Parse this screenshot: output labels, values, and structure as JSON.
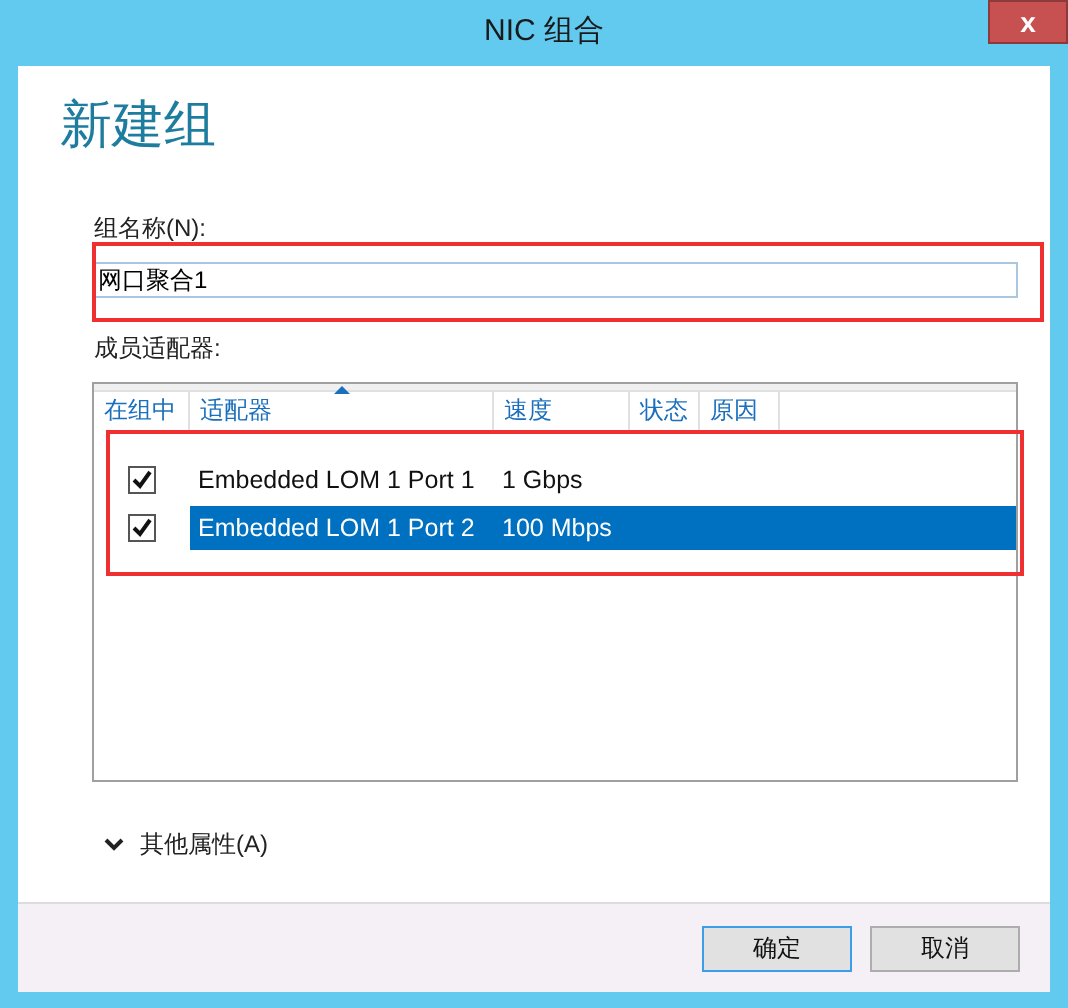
{
  "window": {
    "title": "NIC 组合",
    "close": "x"
  },
  "heading": "新建组",
  "team_name": {
    "label": "组名称(N):",
    "value": "网口聚合1"
  },
  "members": {
    "label": "成员适配器:",
    "columns": [
      {
        "label": "在组中",
        "sorted": false
      },
      {
        "label": "适配器",
        "sorted": true
      },
      {
        "label": "速度",
        "sorted": false
      },
      {
        "label": "状态",
        "sorted": false
      },
      {
        "label": "原因",
        "sorted": false
      }
    ],
    "rows": [
      {
        "checked": true,
        "adapter": "Embedded LOM 1 Port 1",
        "speed": "1 Gbps",
        "selected": false
      },
      {
        "checked": true,
        "adapter": "Embedded LOM 1 Port 2",
        "speed": "100 Mbps",
        "selected": true
      }
    ]
  },
  "more": {
    "label": "其他属性(A)",
    "expanded": false
  },
  "buttons": [
    {
      "label": "确定",
      "focused": true
    },
    {
      "label": "取消",
      "focused": false
    }
  ]
}
